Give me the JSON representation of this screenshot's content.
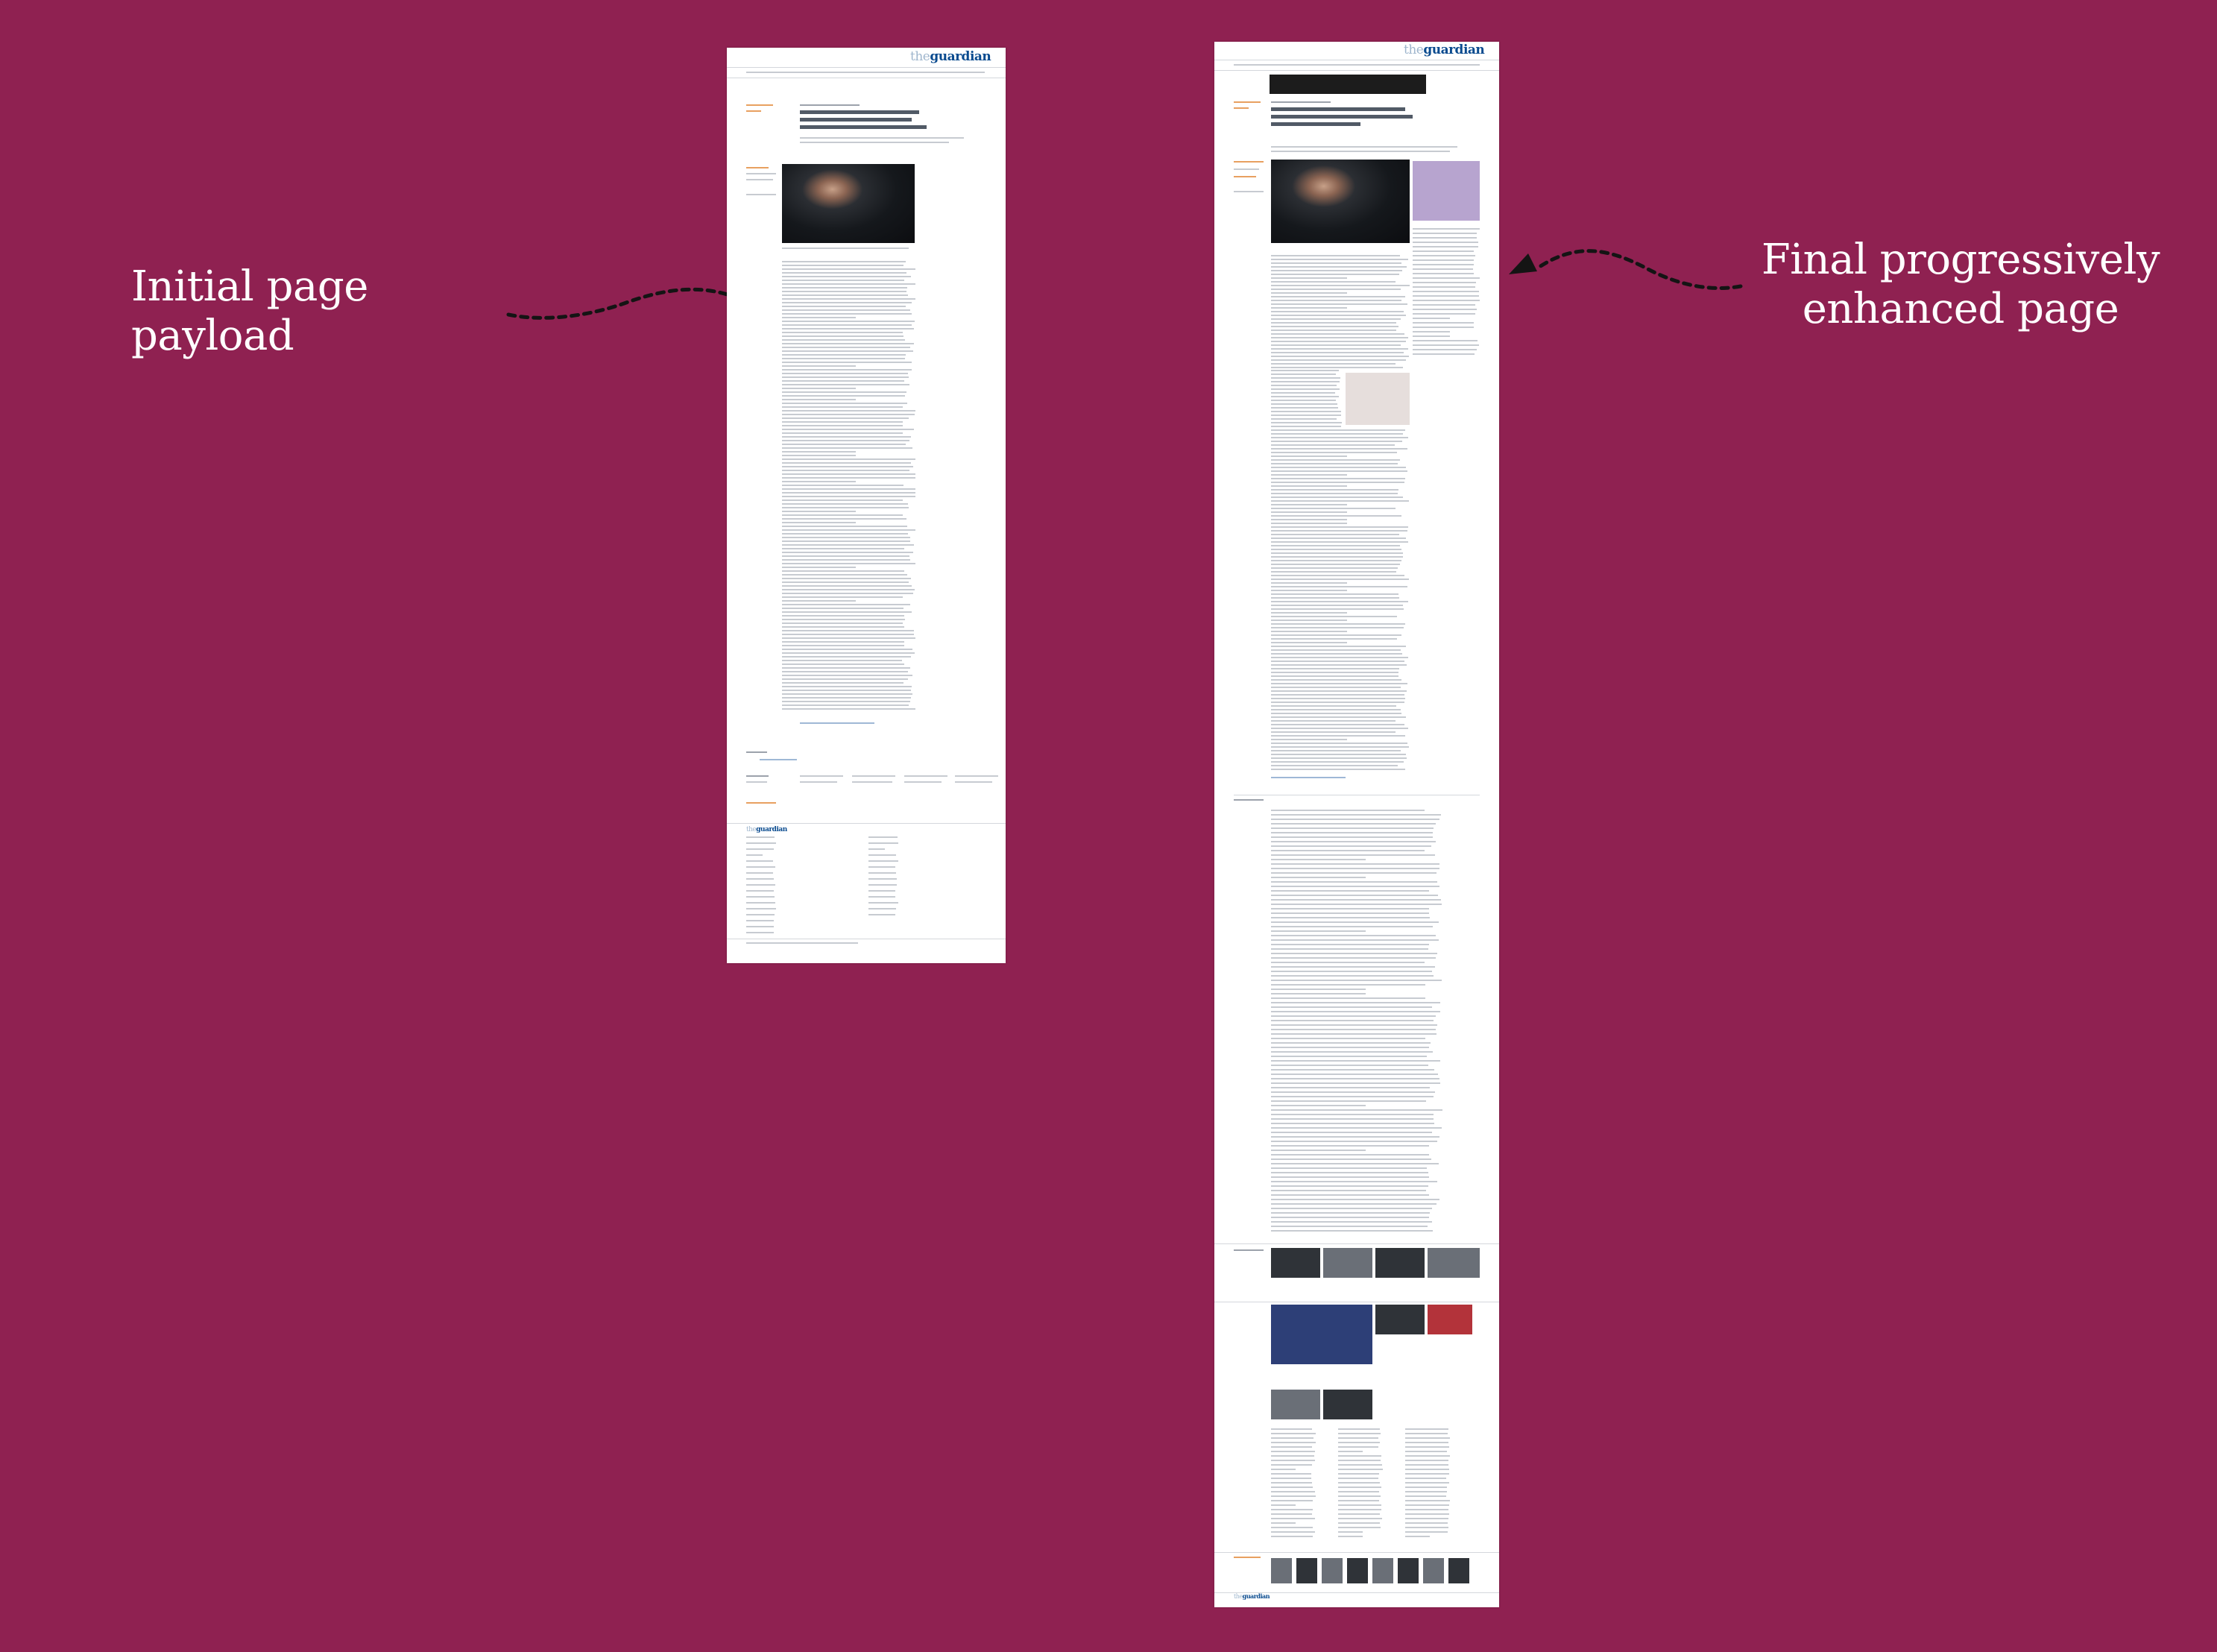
{
  "captions": {
    "initial": "Initial page payload",
    "final": "Final progressively enhanced page"
  },
  "colors": {
    "background": "#8f2151",
    "caption_text": "#ffffff",
    "guardian_blue": "#0a4b8f"
  },
  "pages": {
    "initial": {
      "masthead_the": "the",
      "masthead_name": "guardian"
    },
    "final": {
      "masthead_the": "the",
      "masthead_name": "guardian"
    }
  },
  "icons": [
    "dashed-curved-arrow-icon"
  ]
}
